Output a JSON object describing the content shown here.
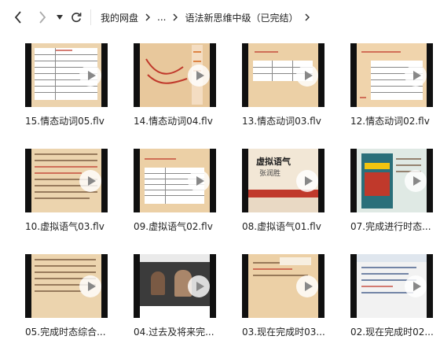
{
  "toolbar": {
    "back_icon": "chevron-left-icon",
    "forward_icon": "chevron-right-icon",
    "dropdown_icon": "caret-down-icon",
    "refresh_icon": "refresh-icon"
  },
  "breadcrumb": {
    "root": "我的网盘",
    "ellipsis": "...",
    "current": "语法新思维中级（已完结）"
  },
  "files": [
    {
      "name": "15.情态动词05.flv"
    },
    {
      "name": "14.情态动词04.flv"
    },
    {
      "name": "13.情态动词03.flv"
    },
    {
      "name": "12.情态动词02.flv"
    },
    {
      "name": "10.虚拟语气03.flv"
    },
    {
      "name": "09.虚拟语气02.flv"
    },
    {
      "name": "08.虚拟语气01.flv"
    },
    {
      "name": "07.完成进行时态..."
    },
    {
      "name": "05.完成时态综合..."
    },
    {
      "name": "04.过去及将来完..."
    },
    {
      "name": "03.现在完成时03..."
    },
    {
      "name": "02.现在完成时02..."
    }
  ],
  "thumb_text": {
    "t7_title": "虚拟语气",
    "t7_name": "张润胜"
  },
  "colors": {
    "background": "#ffffff",
    "thumb_border": "#101010",
    "slide_bg": "#e9c79a",
    "play_button": "#ffffff"
  }
}
